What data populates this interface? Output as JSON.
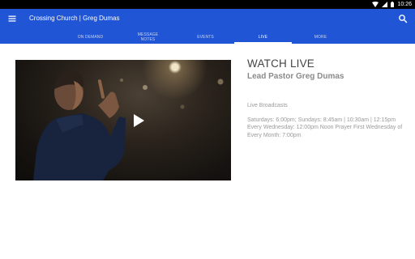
{
  "status_bar": {
    "time": "10:26",
    "icons": [
      "wifi-icon",
      "signal-icon",
      "battery-icon"
    ]
  },
  "app_bar": {
    "title": "Crossing Church | Greg Dumas",
    "color": "#2055d6"
  },
  "tabs": [
    {
      "label": "ON DEMAND",
      "active": false
    },
    {
      "label": "MESSAGE NOTES",
      "active": false
    },
    {
      "label": "EVENTS",
      "active": false
    },
    {
      "label": "LIVE",
      "active": true
    },
    {
      "label": "MORE",
      "active": false
    }
  ],
  "main": {
    "video": {
      "play_icon": "play-icon"
    },
    "heading": "WATCH LIVE",
    "subheading": "Lead Pastor Greg Dumas",
    "broadcasts_label": "Live Broadcasts",
    "schedule": "Saturdays: 6:00pm; Sundays: 8:45am | 10:30am | 12:15pm Every Wednesday: 12:00pm Noon Prayer First Wednesday of Every Month: 7:00pm"
  }
}
